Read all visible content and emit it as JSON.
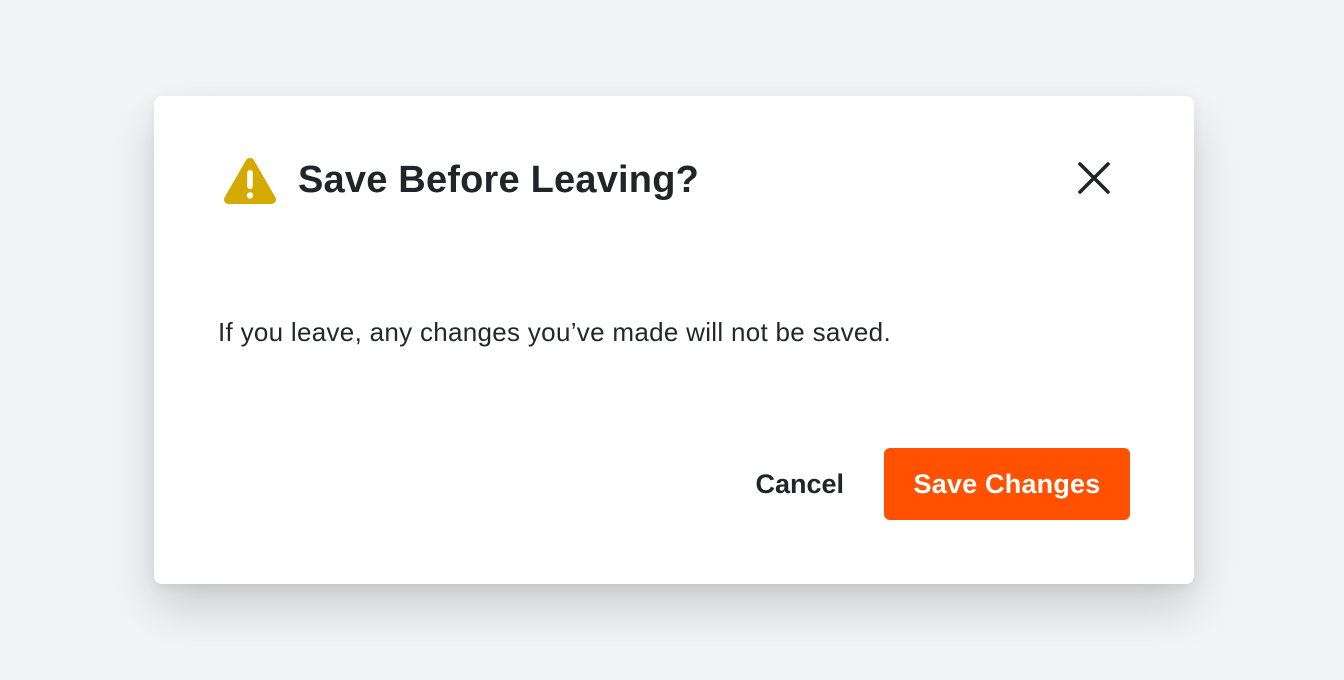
{
  "dialog": {
    "title": "Save Before Leaving?",
    "message": "If you leave, any changes you’ve made will not be saved.",
    "cancel_label": "Cancel",
    "save_label": "Save Changes",
    "icons": {
      "warning": "warning-triangle-icon",
      "close": "close-icon"
    }
  },
  "colors": {
    "background": "#f3f4f6",
    "warning": "#d4a900",
    "primary": "#ff5100",
    "text": "#222428"
  }
}
